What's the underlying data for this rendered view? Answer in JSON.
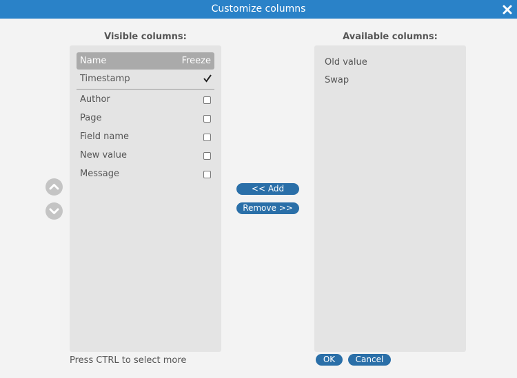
{
  "dialog": {
    "title": "Customize columns",
    "close_icon": "close-icon"
  },
  "visible_columns": {
    "title": "Visible columns:",
    "header": {
      "name": "Name",
      "freeze": "Freeze"
    },
    "rows": [
      {
        "label": "Timestamp",
        "freeze": true
      },
      {
        "label": "Author",
        "freeze": false
      },
      {
        "label": "Page",
        "freeze": false
      },
      {
        "label": "Field name",
        "freeze": false
      },
      {
        "label": "New value",
        "freeze": false
      },
      {
        "label": "Message",
        "freeze": false
      }
    ]
  },
  "available_columns": {
    "title": "Available columns:",
    "items": [
      "Old value",
      "Swap"
    ]
  },
  "actions": {
    "add_label": "<<  Add",
    "remove_label": "Remove  >>",
    "ok_label": "OK",
    "cancel_label": "Cancel"
  },
  "hint": "Press CTRL to select more",
  "colors": {
    "title_bar": "#2a82c8",
    "button": "#2a6fa8",
    "panel": "#e4e4e4",
    "header": "#aaaaaa"
  }
}
